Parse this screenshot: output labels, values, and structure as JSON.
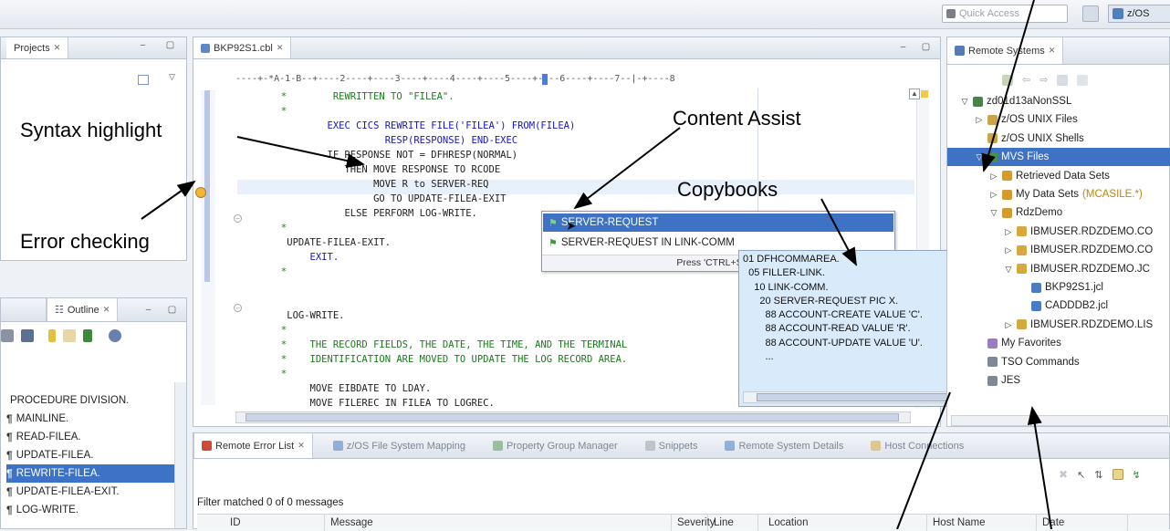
{
  "toolbar": {
    "quick_access_placeholder": "Quick Access",
    "perspective_label": "z/OS"
  },
  "projects": {
    "tab_label": "Projects"
  },
  "editor": {
    "tab_label": "BKP92S1.cbl",
    "ruler": "----+-*A-1-B--+----2----+----3----+----4----+----5----+----6----+----7--|-+----8",
    "lines": [
      {
        "text": "      *        REWRITTEN TO \"FILEA\".",
        "type": "comment"
      },
      {
        "text": "      *",
        "type": "comment"
      },
      {
        "text": "              EXEC CICS REWRITE FILE('FILEA') FROM(FILEA)",
        "type": "keyword"
      },
      {
        "text": "                        RESP(RESPONSE) END-EXEC",
        "type": "keyword"
      },
      {
        "text": "              IF RESPONSE NOT = DFHRESP(NORMAL)",
        "type": "mixed"
      },
      {
        "text": "                 THEN MOVE RESPONSE TO RCODE",
        "type": "mixed"
      },
      {
        "text": "                      MOVE R to SERVER-REQ",
        "type": "mixed"
      },
      {
        "text": "                      GO TO UPDATE-FILEA-EXIT",
        "type": "mixed"
      },
      {
        "text": "                 ELSE PERFORM LOG-WRITE.",
        "type": "mixed"
      },
      {
        "text": "      *",
        "type": "comment"
      },
      {
        "text": "       UPDATE-FILEA-EXIT.",
        "type": "plain"
      },
      {
        "text": "           EXIT.",
        "type": "keyword"
      },
      {
        "text": "      *",
        "type": "comment"
      },
      {
        "text": "",
        "type": "plain"
      },
      {
        "text": "",
        "type": "plain"
      },
      {
        "text": "       LOG-WRITE.",
        "type": "plain"
      },
      {
        "text": "      *",
        "type": "comment"
      },
      {
        "text": "      *    THE RECORD FIELDS, THE DATE, THE TIME, AND THE TERMINAL",
        "type": "comment"
      },
      {
        "text": "      *    IDENTIFICATION ARE MOVED TO UPDATE THE LOG RECORD AREA.",
        "type": "comment"
      },
      {
        "text": "      *",
        "type": "comment"
      },
      {
        "text": "           MOVE EIBDATE TO LDAY.",
        "type": "mixed"
      },
      {
        "text": "           MOVE FILEREC IN FILEA TO LOGREC.",
        "type": "mixed"
      }
    ]
  },
  "content_assist": {
    "items": [
      "SERVER-REQUEST",
      "SERVER-REQUEST IN LINK-COMM"
    ],
    "footer": "Press 'CTRL+SPACE' to view Template Proposals"
  },
  "copybook_popup": {
    "lines": [
      "01 DFHCOMMAREA.",
      "  05 FILLER-LINK.",
      "    10 LINK-COMM.",
      "      20 SERVER-REQUEST PIC X.",
      "        88 ACCOUNT-CREATE VALUE 'C'.",
      "        88 ACCOUNT-READ VALUE 'R'.",
      "        88 ACCOUNT-UPDATE VALUE 'U'.",
      "        ..."
    ]
  },
  "remote_systems": {
    "tab_label": "Remote Systems",
    "tree": [
      {
        "label": "zd01d13aNonSSL",
        "extra": "",
        "level": 0,
        "expander": "open",
        "selected": false
      },
      {
        "label": "z/OS UNIX Files",
        "extra": "",
        "level": 1,
        "expander": "closed",
        "selected": false
      },
      {
        "label": "z/OS UNIX Shells",
        "extra": "",
        "level": 1,
        "expander": "none",
        "selected": false
      },
      {
        "label": "MVS Files",
        "extra": "",
        "level": 1,
        "expander": "open",
        "selected": true
      },
      {
        "label": "Retrieved Data Sets",
        "extra": "",
        "level": 2,
        "expander": "closed",
        "selected": false
      },
      {
        "label": "My Data Sets",
        "extra": "(MCASILE.*)",
        "level": 2,
        "expander": "closed",
        "selected": false
      },
      {
        "label": "RdzDemo",
        "extra": "",
        "level": 2,
        "expander": "open",
        "selected": false
      },
      {
        "label": "IBMUSER.RDZDEMO.CO",
        "extra": "",
        "level": 3,
        "expander": "closed",
        "selected": false
      },
      {
        "label": "IBMUSER.RDZDEMO.CO",
        "extra": "",
        "level": 3,
        "expander": "closed",
        "selected": false
      },
      {
        "label": "IBMUSER.RDZDEMO.JC",
        "extra": "",
        "level": 3,
        "expander": "open",
        "selected": false
      },
      {
        "label": "BKP92S1.jcl",
        "extra": "",
        "level": 4,
        "expander": "none",
        "selected": false
      },
      {
        "label": "CADDDB2.jcl",
        "extra": "",
        "level": 4,
        "expander": "none",
        "selected": false
      },
      {
        "label": "IBMUSER.RDZDEMO.LIS",
        "extra": "",
        "level": 3,
        "expander": "closed",
        "selected": false
      },
      {
        "label": "My Favorites",
        "extra": "",
        "level": 1,
        "expander": "none",
        "selected": false
      },
      {
        "label": "TSO Commands",
        "extra": "",
        "level": 1,
        "expander": "none",
        "selected": false
      },
      {
        "label": "JES",
        "extra": "",
        "level": 1,
        "expander": "none",
        "selected": false
      }
    ]
  },
  "outline": {
    "tab_label": "Outline",
    "items": [
      {
        "label": "PROCEDURE DIVISION.",
        "selected": false,
        "para": false
      },
      {
        "label": "MAINLINE.",
        "selected": false,
        "para": true
      },
      {
        "label": "READ-FILEA.",
        "selected": false,
        "para": true
      },
      {
        "label": "UPDATE-FILEA.",
        "selected": false,
        "para": true
      },
      {
        "label": "REWRITE-FILEA.",
        "selected": true,
        "para": true
      },
      {
        "label": "UPDATE-FILEA-EXIT.",
        "selected": false,
        "para": true
      },
      {
        "label": "LOG-WRITE.",
        "selected": false,
        "para": true
      }
    ]
  },
  "bottom_panel": {
    "tabs": [
      {
        "label": "Remote Error List",
        "active": true
      },
      {
        "label": "z/OS File System Mapping",
        "active": false
      },
      {
        "label": "Property Group Manager",
        "active": false
      },
      {
        "label": "Snippets",
        "active": false
      },
      {
        "label": "Remote System Details",
        "active": false
      },
      {
        "label": "Host Connections",
        "active": false
      }
    ],
    "filter_text": "Filter matched 0 of 0 messages",
    "columns": [
      "ID",
      "Message",
      "Severity",
      "Line",
      "Location",
      "Host Name",
      "Date"
    ]
  },
  "callouts": {
    "syntax": "Syntax highlight",
    "error": "Error checking",
    "assist": "Content Assist",
    "copybooks": "Copybooks"
  },
  "colors": {
    "selection": "#3d72c4",
    "keyword": "#1515c8",
    "comment": "#1c7a1c",
    "line_highlight": "#e8f0fb"
  }
}
